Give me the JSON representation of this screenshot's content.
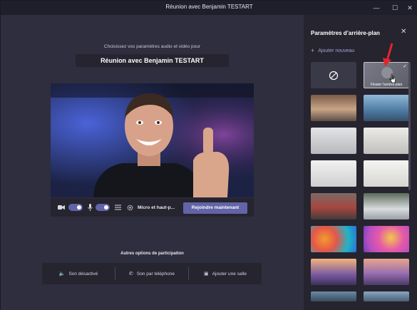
{
  "window": {
    "title": "Réunion avec Benjamin TESTART"
  },
  "main": {
    "subtitle": "Choisissez vos paramètres audio et vidéo pour",
    "meeting_title": "Réunion avec Benjamin TESTART",
    "controls": {
      "audio_device_label": "Micro et haut-p...",
      "join_label": "Rejoindre maintenant"
    },
    "other_options": {
      "title": "Autres options de participation",
      "items": [
        {
          "label": "Son désactivé",
          "icon": "speaker-off-icon"
        },
        {
          "label": "Son par téléphone",
          "icon": "phone-icon"
        },
        {
          "label": "Ajouter une salle",
          "icon": "room-icon"
        }
      ]
    }
  },
  "panel": {
    "title": "Paramètres d’arrière-plan",
    "add_new_label": "Ajouter nouveau",
    "blur_label": "Flouter l’arrière-plan",
    "colors": {
      "accent": "#6264a7",
      "arrow": "#e3262a"
    }
  }
}
